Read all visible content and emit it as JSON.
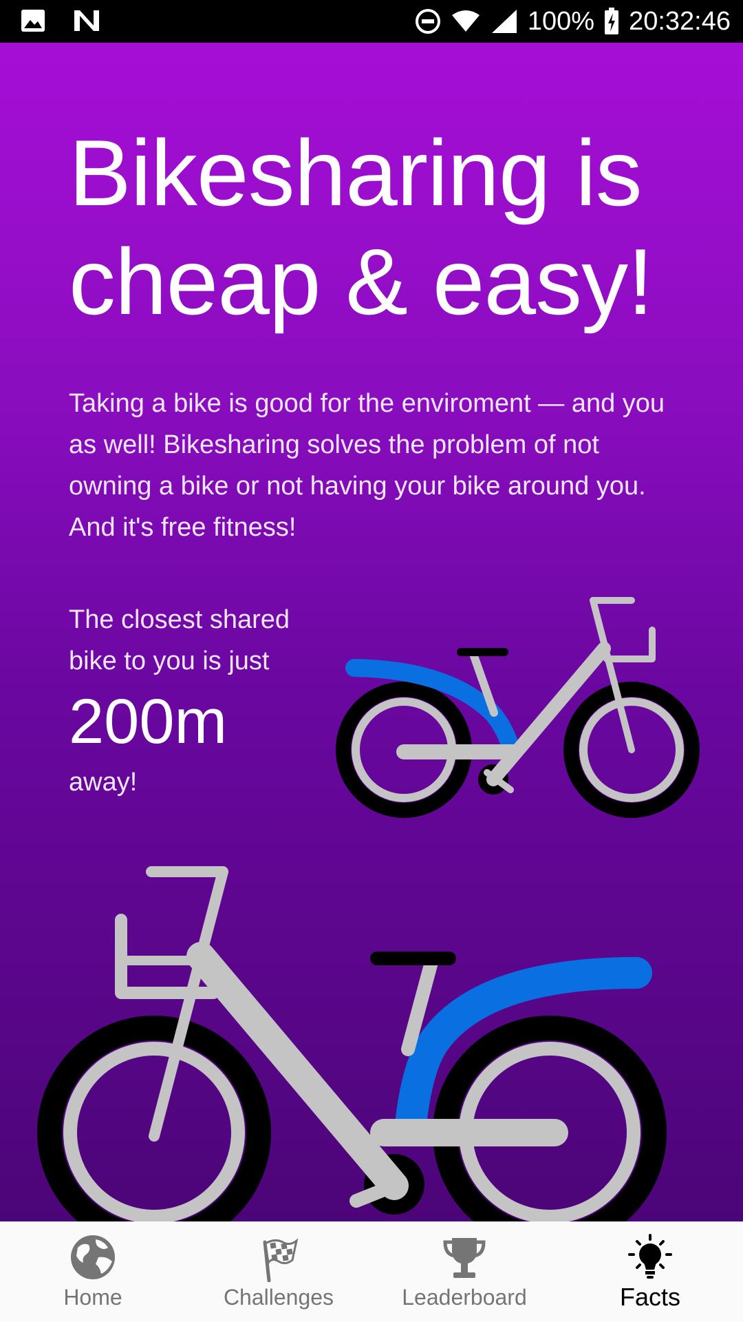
{
  "status_bar": {
    "battery": "100%",
    "time": "20:32:46",
    "icons": [
      "image-icon",
      "n-icon",
      "do-not-disturb-icon",
      "wifi-icon",
      "cell-signal-icon",
      "battery-charging-icon"
    ]
  },
  "facts": {
    "headline": "Bikesharing is cheap & easy!",
    "paragraph": "Taking a bike is good for the enviroment — and you as well! Bikesharing solves the problem of not owning a bike or not having your bike around you. And it's free fitness!",
    "closest_prefix": "The closest shared bike to you is just",
    "distance": "200m",
    "closest_suffix": "away!"
  },
  "colors": {
    "gradient_top": "#a60ed6",
    "gradient_bottom": "#4c0578",
    "bike_frame": "#c4c4c4",
    "bike_fender": "#0a6fe0",
    "tire": "#000000"
  },
  "bottom_nav": {
    "items": [
      {
        "label": "Home",
        "icon": "globe-icon",
        "active": false
      },
      {
        "label": "Challenges",
        "icon": "checkered-flag-icon",
        "active": false
      },
      {
        "label": "Leaderboard",
        "icon": "trophy-icon",
        "active": false
      },
      {
        "label": "Facts",
        "icon": "lightbulb-icon",
        "active": true
      }
    ]
  }
}
